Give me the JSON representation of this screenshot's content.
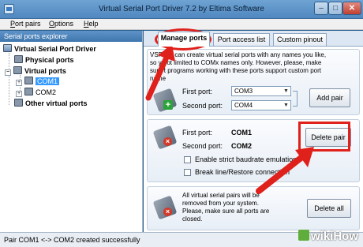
{
  "window": {
    "title": "Virtual Serial Port Driver 7.2 by Eltima Software",
    "min_label": "–",
    "max_label": "□",
    "close_label": "✕"
  },
  "menu": {
    "items": [
      {
        "label": "Port pairs",
        "accel": "P",
        "rest": "ort pairs"
      },
      {
        "label": "Options",
        "accel": "O",
        "rest": "ptions"
      },
      {
        "label": "Help",
        "accel": "H",
        "rest": "elp"
      }
    ]
  },
  "explorer": {
    "header": "Serial ports explorer",
    "root": "Virtual Serial Port Driver",
    "physical": "Physical ports",
    "virtual": "Virtual ports",
    "ports": [
      "COM1",
      "COM2"
    ],
    "other": "Other virtual ports",
    "selected_port": "COM1"
  },
  "tabs": [
    {
      "label": "Manage ports",
      "active": true
    },
    {
      "label": "Port access list",
      "active": false
    },
    {
      "label": "Custom pinout",
      "active": false
    }
  ],
  "add_group": {
    "desc_line1": "VSP          ma can create virtual serial ports with any names you like,",
    "desc_line2": "so y          not limited to COMx names only. However, please, make",
    "desc_line3": "sure          t programs working with these ports support custom port",
    "desc_line4": "name",
    "first_port_label": "First port:",
    "first_port_value": "COM3",
    "second_port_label": "Second port:",
    "second_port_value": "COM4",
    "add_button": "Add pair"
  },
  "delete_group": {
    "first_port_label": "First port:",
    "first_port_value": "COM1",
    "second_port_label": "Second port:",
    "second_port_value": "COM2",
    "delete_button": "Delete pair",
    "strict_baud": "Enable strict baudrate emulation",
    "break_line": "Break line/Restore connection"
  },
  "delete_all_group": {
    "desc_line1": "All virtual serial pairs will be",
    "desc_line2": "removed from your system.",
    "desc_line3": "Please, make sure all ports are",
    "desc_line4": "closed.",
    "delete_all_button": "Delete all"
  },
  "status": {
    "text": "Pair COM1 <-> COM2 created successfully"
  },
  "watermark": {
    "text": "wikiHow"
  },
  "colors": {
    "callout": "#e0201b",
    "accent": "#3399ff"
  }
}
